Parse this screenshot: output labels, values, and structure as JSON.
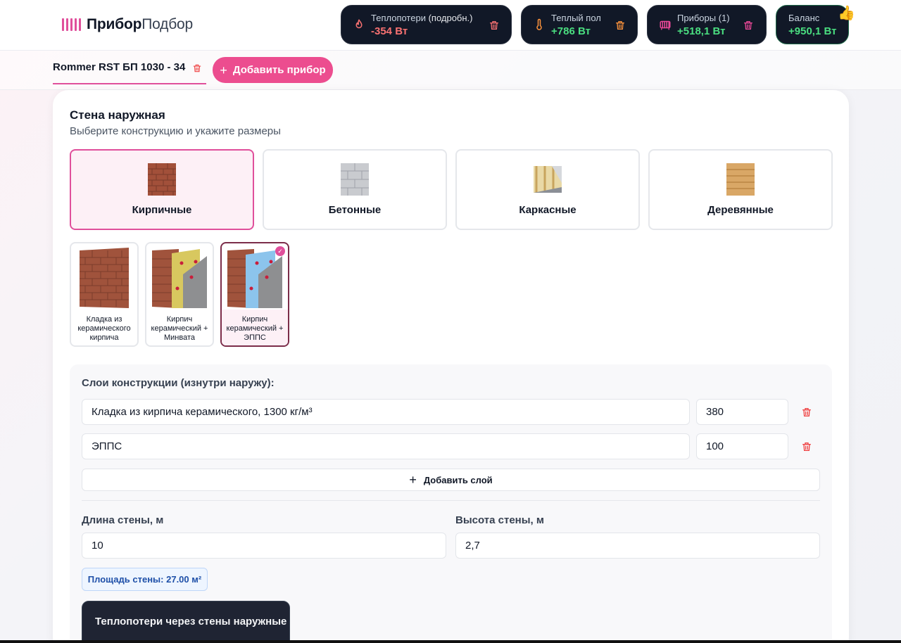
{
  "logo": {
    "bold": "Прибор",
    "regular": "Подбор"
  },
  "stats": [
    {
      "label": "Теплопотери ",
      "label_extra": "(подробн.)",
      "value": "-354 Вт",
      "icon": "flame-icon",
      "color": "#f87171"
    },
    {
      "label": "Теплый пол",
      "value": "+786 Вт",
      "icon": "thermometer-icon",
      "color": "#4ade80"
    },
    {
      "label": "Приборы (1)",
      "value": "+518,1 Вт",
      "icon": "radiator-icon",
      "color": "#4ade80"
    },
    {
      "label": "Баланс",
      "value": "+950,1 Вт",
      "icon": "thumbs-up-icon",
      "color": "#4ade80"
    }
  ],
  "device_tab": {
    "label": "Rommer RST БП 1030 - 34"
  },
  "add_device_label": "Добавить прибор",
  "section": {
    "title": "Стена наружная",
    "subtitle": "Выберите конструкцию и укажите размеры"
  },
  "types": [
    {
      "label": "Кирпичные",
      "selected": true
    },
    {
      "label": "Бетонные",
      "selected": false
    },
    {
      "label": "Каркасные",
      "selected": false
    },
    {
      "label": "Деревянные",
      "selected": false
    }
  ],
  "variants": [
    {
      "label": "Кладка из керамического кирпича",
      "selected": false
    },
    {
      "label": "Кирпич керамический + Минвата",
      "selected": false
    },
    {
      "label": "Кирпич керамический + ЭППС",
      "selected": true
    }
  ],
  "layers_title": "Слои конструкции (изнутри наружу):",
  "layers": [
    {
      "material": "Кладка из кирпича керамического, 1300 кг/м³",
      "thickness": "380"
    },
    {
      "material": "ЭППС",
      "thickness": "100"
    }
  ],
  "add_layer_label": "Добавить слой",
  "length": {
    "label": "Длина стены, м",
    "value": "10"
  },
  "height": {
    "label": "Высота стены, м",
    "value": "2,7"
  },
  "area_label": "Площадь стены: 27.00 м²",
  "result": {
    "title": "Теплопотери через стены наружные"
  }
}
